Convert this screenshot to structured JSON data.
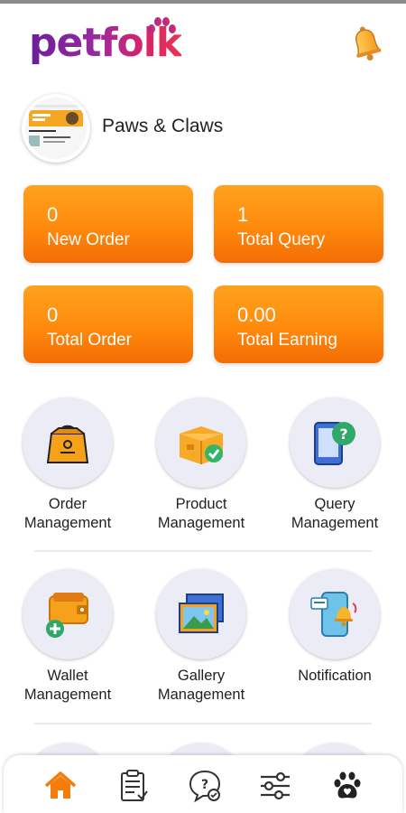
{
  "app": {
    "logo_text": "petfolk"
  },
  "header": {
    "bell_icon": "bell-icon"
  },
  "profile": {
    "store_name": "Paws & Claws"
  },
  "stats": [
    {
      "value": "0",
      "label": "New Order"
    },
    {
      "value": "1",
      "label": "Total Query"
    },
    {
      "value": "0",
      "label": "Total Order"
    },
    {
      "value": "0.00",
      "label": "Total Earning"
    }
  ],
  "menu": [
    {
      "line1": "Order",
      "line2": "Management",
      "icon": "shopping-bag-icon"
    },
    {
      "line1": "Product",
      "line2": "Management",
      "icon": "product-box-icon"
    },
    {
      "line1": "Query",
      "line2": "Management",
      "icon": "query-phone-icon"
    },
    {
      "line1": "Wallet",
      "line2": "Management",
      "icon": "wallet-icon"
    },
    {
      "line1": "Gallery",
      "line2": "Management",
      "icon": "gallery-icon"
    },
    {
      "line1": "Notification",
      "line2": "",
      "icon": "notification-phone-icon"
    }
  ],
  "bottom_nav": [
    {
      "icon": "home-icon",
      "active": true
    },
    {
      "icon": "orders-list-icon",
      "active": false
    },
    {
      "icon": "query-chat-icon",
      "active": false
    },
    {
      "icon": "settings-sliders-icon",
      "active": false
    },
    {
      "icon": "paw-profile-icon",
      "active": false
    }
  ],
  "colors": {
    "accent": "#f57c0a",
    "stat_top": "#ffa21d",
    "stat_bottom": "#f26d05",
    "tile_bg": "#ececf6",
    "brand_purple": "#6a1f9a",
    "brand_pink": "#e8344f"
  }
}
